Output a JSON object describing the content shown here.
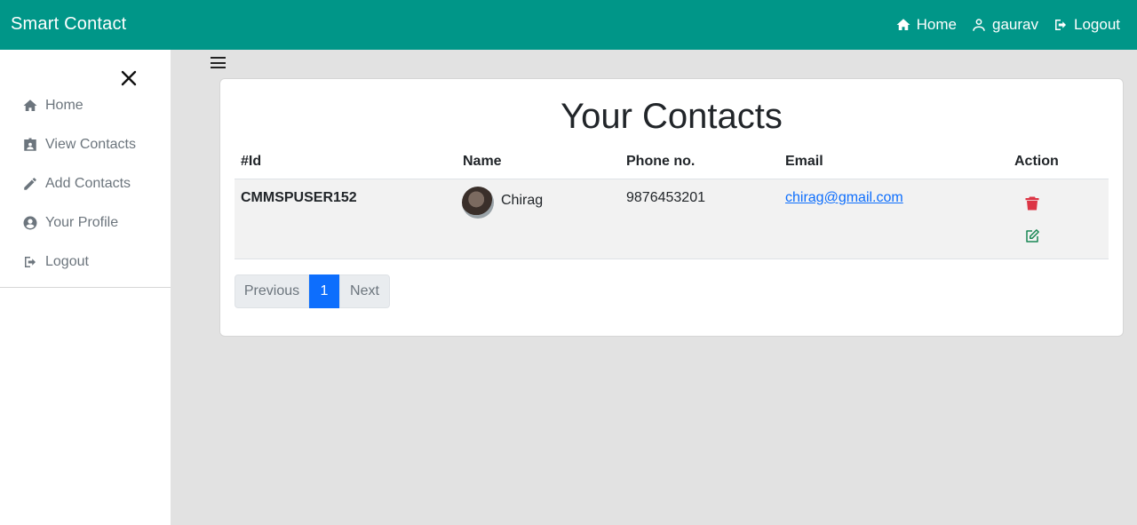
{
  "header": {
    "brand": "Smart Contact",
    "links": [
      {
        "label": "Home",
        "icon": "home-icon"
      },
      {
        "label": "gaurav",
        "icon": "user-icon"
      },
      {
        "label": "Logout",
        "icon": "logout-icon"
      }
    ]
  },
  "sidebar": {
    "items": [
      {
        "label": "Home",
        "icon": "home-icon"
      },
      {
        "label": "View Contacts",
        "icon": "contact-card-icon"
      },
      {
        "label": "Add Contacts",
        "icon": "pencil-icon"
      },
      {
        "label": "Your Profile",
        "icon": "user-circle-icon"
      },
      {
        "label": "Logout",
        "icon": "logout-icon"
      }
    ]
  },
  "main": {
    "title": "Your Contacts",
    "columns": [
      "#Id",
      "Name",
      "Phone no.",
      "Email",
      "Action"
    ],
    "rows": [
      {
        "id": "CMMSPUSER152",
        "name": "Chirag",
        "phone": "9876453201",
        "email": "chirag@gmail.com"
      }
    ],
    "pagination": {
      "previous": "Previous",
      "current": "1",
      "next": "Next"
    }
  },
  "colors": {
    "navbar": "#009688",
    "delete": "#dc3545",
    "edit": "#198754",
    "active_page": "#0d6efd"
  }
}
